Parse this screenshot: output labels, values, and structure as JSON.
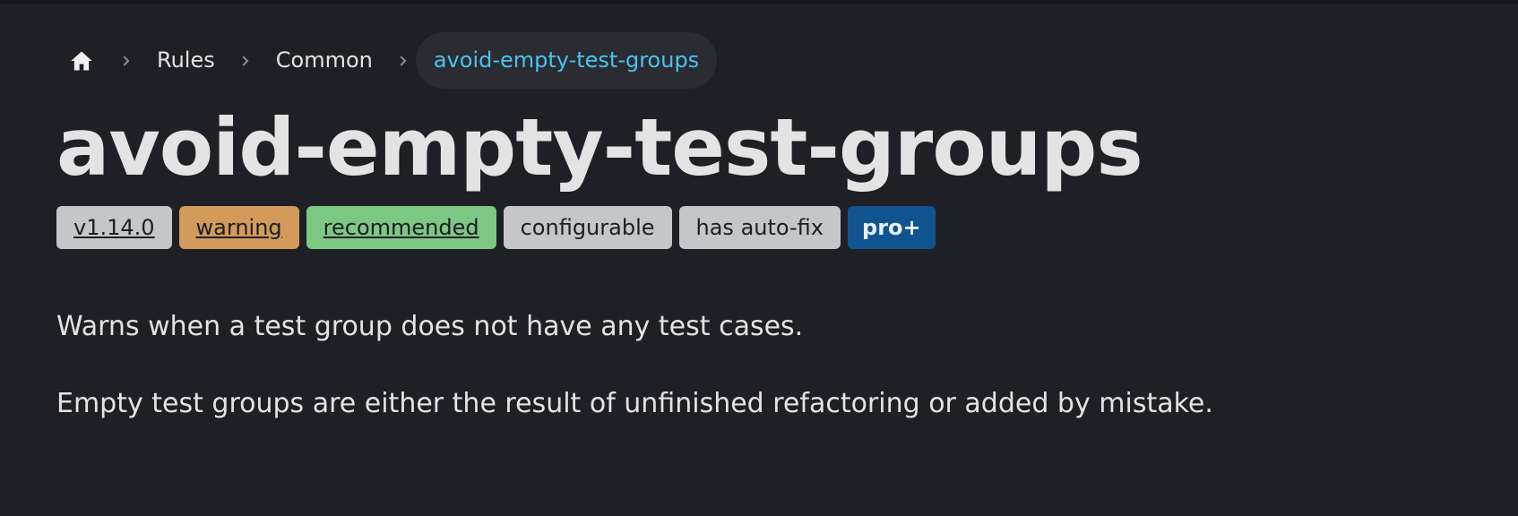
{
  "breadcrumb": {
    "home_icon": "home-icon",
    "separator_icon": "chevron-right-icon",
    "items": [
      {
        "label": "Rules"
      },
      {
        "label": "Common"
      },
      {
        "label": "avoid-empty-test-groups"
      }
    ]
  },
  "page": {
    "title": "avoid-empty-test-groups"
  },
  "badges": {
    "version": "v1.14.0",
    "severity": "warning",
    "recommended": "recommended",
    "configurable": "configurable",
    "autofix": "has auto-fix",
    "tier": "pro+"
  },
  "description": {
    "line1": "Warns when a test group does not have any test cases.",
    "line2": "Empty test groups are either the result of unfinished refactoring or added by mistake."
  },
  "colors": {
    "background": "#1e2025",
    "text": "#e3e3e3",
    "accent": "#4cc2ef",
    "warning": "#d39a5c",
    "recommended": "#7dc785",
    "neutral_badge": "#c5c6c9",
    "pro": "#0f5490"
  }
}
